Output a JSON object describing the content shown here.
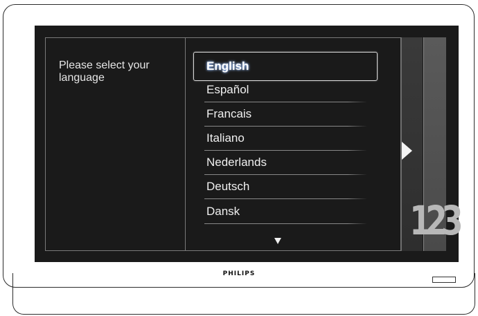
{
  "device": {
    "brand": "PHILIPS"
  },
  "screen": {
    "prompt": "Please select your language",
    "languages": [
      {
        "label": "English",
        "selected": true
      },
      {
        "label": "Español",
        "selected": false
      },
      {
        "label": "Francais",
        "selected": false
      },
      {
        "label": "Italiano",
        "selected": false
      },
      {
        "label": "Nederlands",
        "selected": false
      },
      {
        "label": "Deutsch",
        "selected": false
      },
      {
        "label": "Dansk",
        "selected": false
      }
    ],
    "step_indicator": "123",
    "icons": {
      "scroll_down": "triangle-down-icon",
      "next": "triangle-right-icon"
    },
    "colors": {
      "screen_bg": "#1a1a1a",
      "text": "#f0f0f0",
      "selected_glow": "#8fb8ff"
    }
  }
}
